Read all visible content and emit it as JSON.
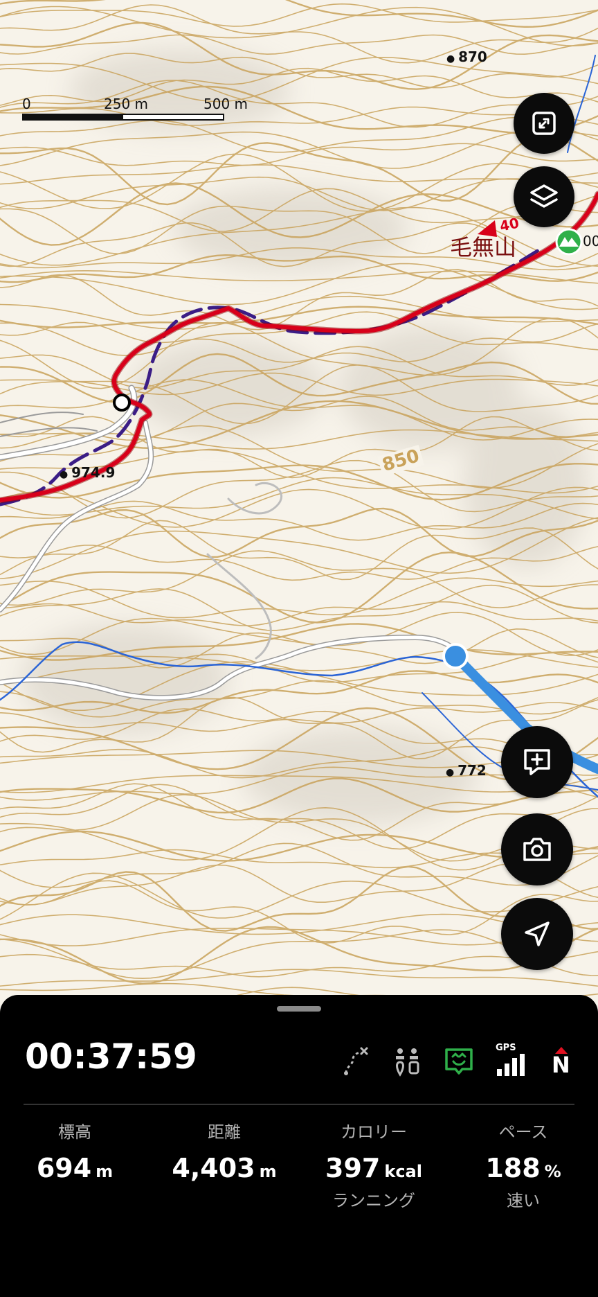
{
  "map": {
    "scale": {
      "labels": [
        "0",
        "250 m",
        "500 m"
      ]
    },
    "peak_labels": [
      {
        "text": "870"
      },
      {
        "text": "974.9"
      },
      {
        "text": "772"
      }
    ],
    "contour_label": "850",
    "mountain_name": "毛無山",
    "marker_number": "40",
    "edge_label": "00"
  },
  "controls": {
    "fullscreen": "fullscreen-icon",
    "layers": "layers-icon",
    "add_note": "add-note-icon",
    "camera": "camera-icon",
    "navigate": "navigate-arrow-icon"
  },
  "panel": {
    "elapsed_time": "00:37:59",
    "status": {
      "gps_label": "GPS",
      "compass_label": "N"
    },
    "stats": [
      {
        "label": "標高",
        "value": "694",
        "unit": "m",
        "sub": ""
      },
      {
        "label": "距離",
        "value": "4,403",
        "unit": "m",
        "sub": ""
      },
      {
        "label": "カロリー",
        "value": "397",
        "unit": "kcal",
        "sub": "ランニング"
      },
      {
        "label": "ペース",
        "value": "188",
        "unit": "%",
        "sub": "速い"
      }
    ]
  },
  "colors": {
    "route": "#d8001a",
    "planned_route": "#3b1d86",
    "contour": "#c9a25a",
    "stream": "#2a64d6",
    "location": "#3a8fe0",
    "panel_bg": "#000000",
    "green_accent": "#2fb04a",
    "compass_red": "#e01020"
  }
}
